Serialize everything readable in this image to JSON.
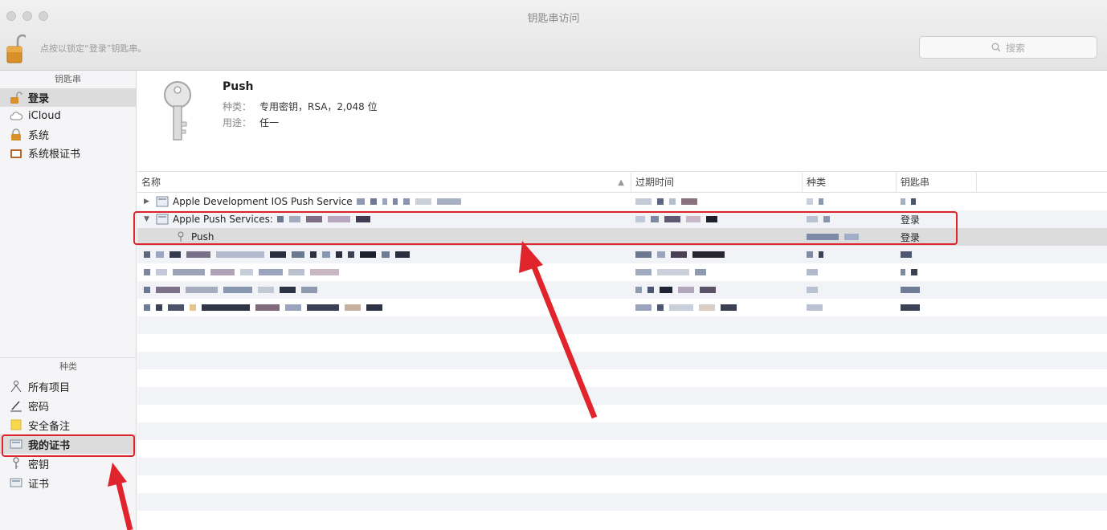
{
  "window": {
    "title": "钥匙串访问",
    "lock_hint": "点按以锁定“登录”钥匙串。",
    "search_placeholder": "搜索"
  },
  "sidebar": {
    "keychains_header": "钥匙串",
    "keychains": [
      {
        "label": "登录",
        "icon": "unlocked-lock-icon",
        "selected": true
      },
      {
        "label": "iCloud",
        "icon": "cloud-icon",
        "selected": false
      },
      {
        "label": "系统",
        "icon": "lock-icon",
        "selected": false
      },
      {
        "label": "系统根证书",
        "icon": "cabinet-icon",
        "selected": false
      }
    ],
    "category_header": "种类",
    "categories": [
      {
        "label": "所有项目",
        "icon": "people-icon"
      },
      {
        "label": "密码",
        "icon": "pen-icon"
      },
      {
        "label": "安全备注",
        "icon": "note-icon"
      },
      {
        "label": "我的证书",
        "icon": "certificate-icon",
        "selected": true
      },
      {
        "label": "密钥",
        "icon": "key-icon"
      },
      {
        "label": "证书",
        "icon": "certificate-icon"
      }
    ]
  },
  "detail": {
    "name": "Push",
    "kind_label": "种类：",
    "kind_value": "专用密钥，RSA，2,048 位",
    "usage_label": "用途：",
    "usage_value": "任一"
  },
  "table": {
    "columns": [
      "名称",
      "过期时间",
      "种类",
      "钥匙串"
    ],
    "rows": [
      {
        "name": "Apple Development IOS Push Service",
        "keychain": "",
        "indent": 0,
        "disclosure": "right"
      },
      {
        "name": "Apple Push Services:",
        "keychain": "登录",
        "indent": 0,
        "disclosure": "down"
      },
      {
        "name": "Push",
        "keychain": "登录",
        "indent": 1,
        "disclosure": ""
      },
      {
        "name": "",
        "keychain": "",
        "indent": 0,
        "disclosure": ""
      },
      {
        "name": "",
        "keychain": "",
        "indent": 0,
        "disclosure": ""
      },
      {
        "name": "",
        "keychain": "",
        "indent": 0,
        "disclosure": ""
      },
      {
        "name": "",
        "keychain": "",
        "indent": 0,
        "disclosure": ""
      }
    ]
  },
  "colors": {
    "highlight": "#e0242c",
    "selection": "#dcdcdc",
    "stripe": "#f1f3f6"
  }
}
